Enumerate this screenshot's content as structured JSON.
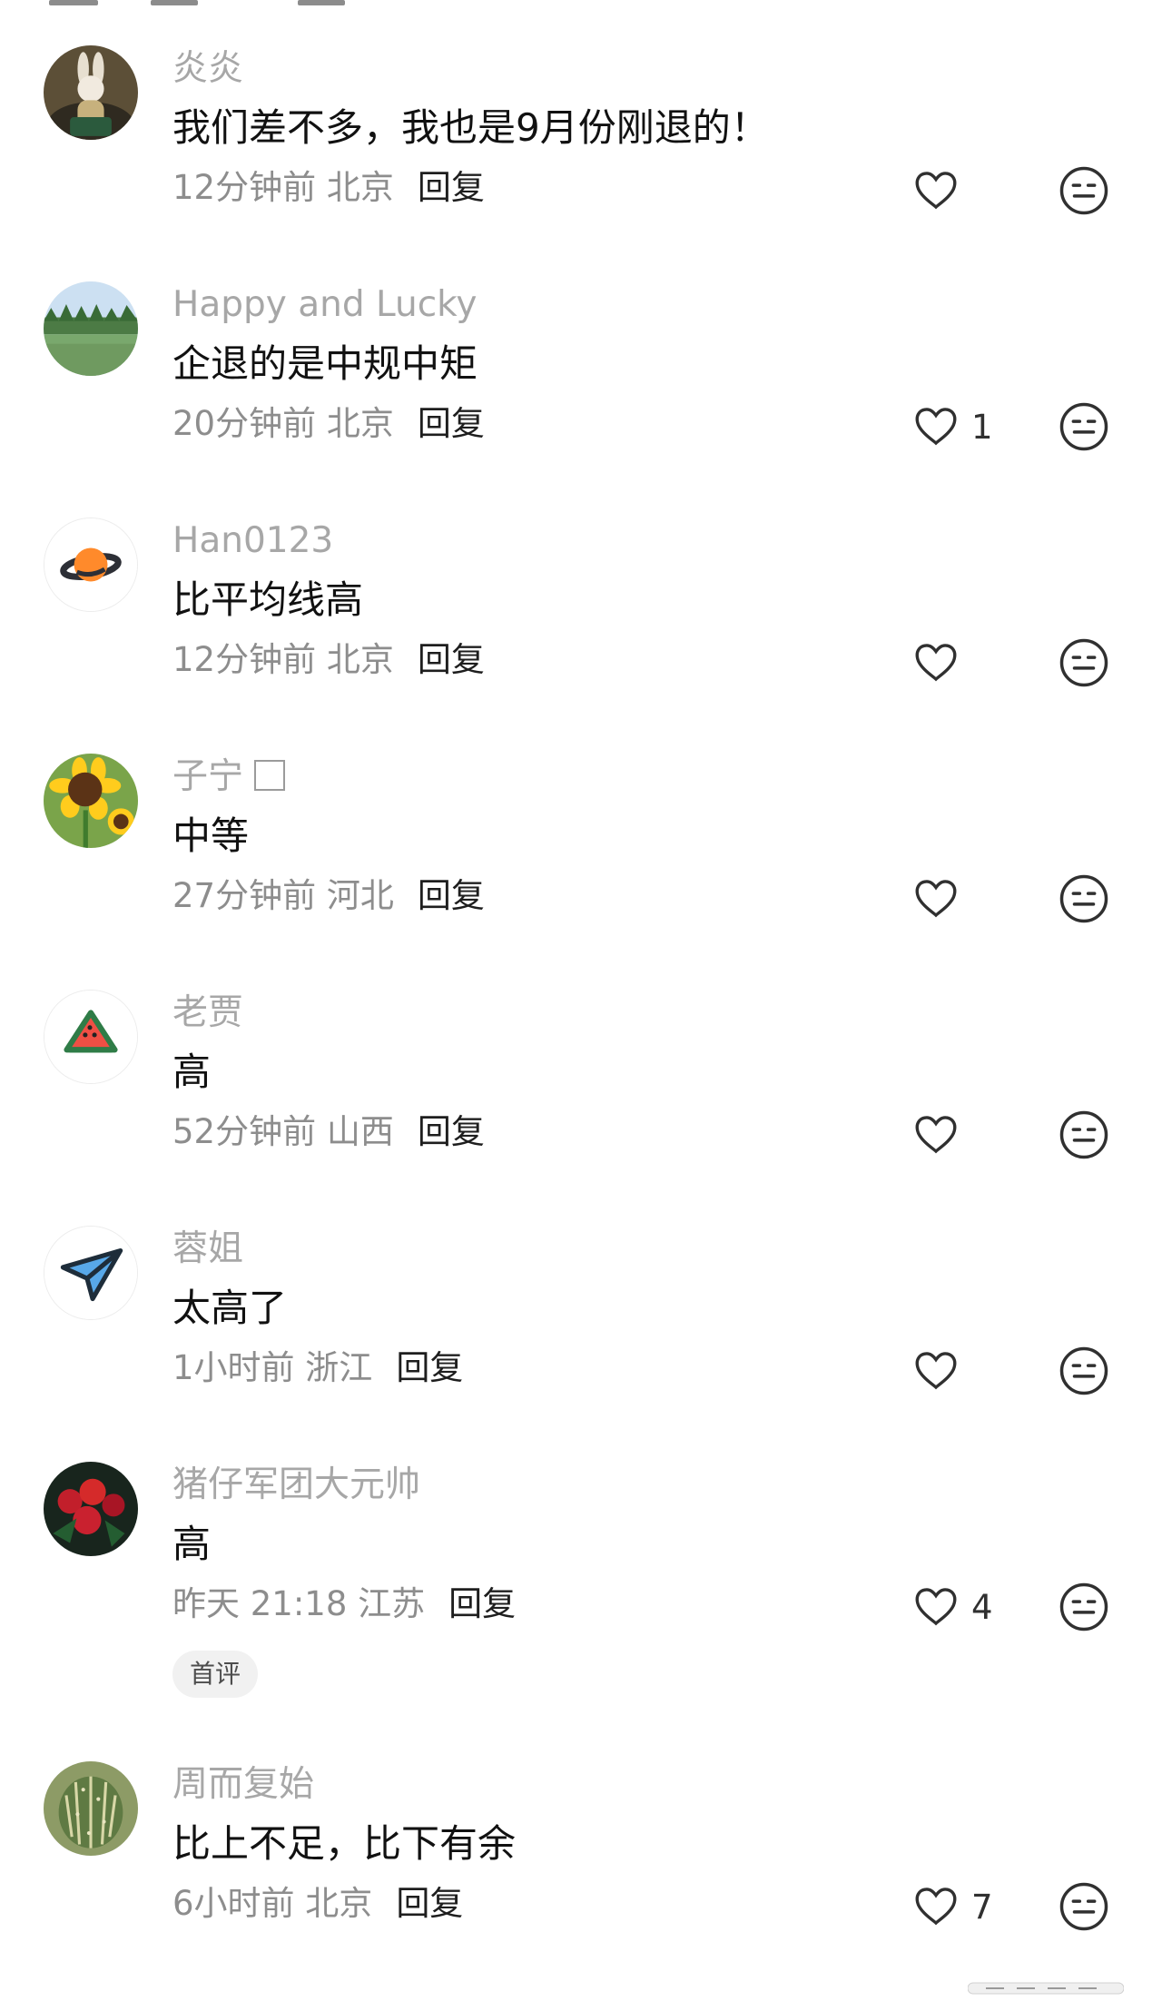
{
  "ui": {
    "reply_label": "回复",
    "first_review_badge": "首评",
    "colors": {
      "background": "#ffffff",
      "username": "#a7a7a7",
      "comment_text": "#111111",
      "meta_text": "#8d8d8d",
      "reply_text": "#1e1e1e",
      "icon_stroke": "#303030",
      "badge_background": "#f1f1f1"
    },
    "icons": {
      "like": "heart-outline-icon",
      "dislike": "neutral-face-icon"
    }
  },
  "comments": [
    {
      "username": "炎炎",
      "text": "我们差不多，我也是9月份刚退的！",
      "meta": "12分钟前 北京",
      "likes": "",
      "avatar": "rabbit-figure-avatar"
    },
    {
      "username": "Happy and Lucky",
      "text": "企退的是中规中矩",
      "meta": "20分钟前 北京",
      "likes": "1",
      "avatar": "lake-landscape-avatar"
    },
    {
      "username": "Han0123",
      "text": "比平均线高",
      "meta": "12分钟前 北京",
      "likes": "",
      "avatar": "planet-avatar"
    },
    {
      "username": "子宁",
      "text": "中等",
      "meta": "27分钟前 河北",
      "likes": "",
      "avatar": "sunflower-avatar"
    },
    {
      "username": "老贾",
      "text": "高",
      "meta": "52分钟前 山西",
      "likes": "",
      "avatar": "watermelon-avatar"
    },
    {
      "username": "蓉姐",
      "text": "太高了",
      "meta": "1小时前 浙江",
      "likes": "",
      "avatar": "paper-plane-avatar"
    },
    {
      "username": "猪仔军团大元帅",
      "text": "高",
      "meta": "昨天 21:18 江苏",
      "likes": "4",
      "avatar": "red-flowers-avatar"
    },
    {
      "username": "周而复始",
      "text": "比上不足，比下有余",
      "meta": "6小时前 北京",
      "likes": "7",
      "avatar": "cactus-avatar"
    }
  ]
}
